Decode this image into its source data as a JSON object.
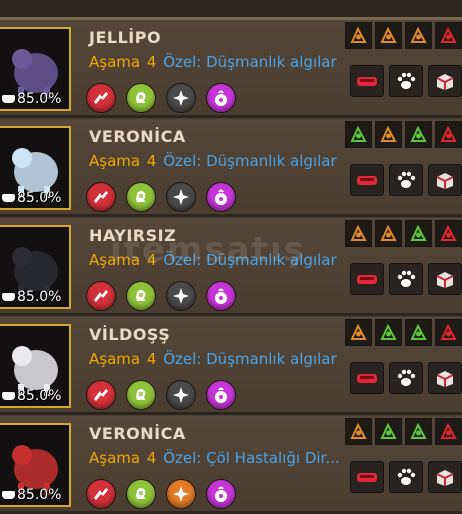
{
  "pets": [
    {
      "name": "JELLİPO",
      "stage_label": "Aşama",
      "stage": "4",
      "special": "Özel: Düşmanlık algılar",
      "percent": "85.0%",
      "features": [
        "horse-icon",
        "potion-icon",
        "turkey-icon",
        "red-arrows-icon"
      ],
      "skills": [
        "red",
        "green",
        "gray",
        "purple"
      ]
    },
    {
      "name": "VERONİCA",
      "stage_label": "Aşama",
      "stage": "4",
      "special": "Özel: Düşmanlık algılar",
      "percent": "85.0%",
      "features": [
        "green-swirl-icon",
        "orange-pick-icon",
        "green-wing-icon",
        "red-target-icon"
      ],
      "skills": [
        "red",
        "green",
        "gray",
        "purple"
      ]
    },
    {
      "name": "HAYIRSIZ",
      "stage_label": "Aşama",
      "stage": "4",
      "special": "Özel: Düşmanlık algılar",
      "percent": "85.0%",
      "features": [
        "hammer-icon",
        "potion-icon",
        "green-arrows-icon",
        "red-arrows-icon"
      ],
      "skills": [
        "red",
        "green",
        "gray",
        "purple"
      ]
    },
    {
      "name": "VİLDOŞŞ",
      "stage_label": "Aşama",
      "stage": "4",
      "special": "Özel: Düşmanlık algılar",
      "percent": "85.0%",
      "features": [
        "scorpion-icon",
        "green-swirl-icon",
        "green-cross-icon",
        "red-axe-icon"
      ],
      "skills": [
        "red",
        "green",
        "gray",
        "purple"
      ]
    },
    {
      "name": "VERONİCA",
      "stage_label": "Aşama",
      "stage": "4",
      "special": "Özel: Çöl Hastalığı Dir...",
      "percent": "85.0%",
      "features": [
        "scorpion-icon",
        "green-swirl-icon",
        "green-wing-icon",
        "red-arrows-icon"
      ],
      "skills": [
        "red",
        "green",
        "orange",
        "purple"
      ]
    }
  ],
  "colors": {
    "gold": "#f0a800",
    "blue": "#4aa3e8",
    "frame": "#d8a82c"
  },
  "watermark": "itemsatış"
}
